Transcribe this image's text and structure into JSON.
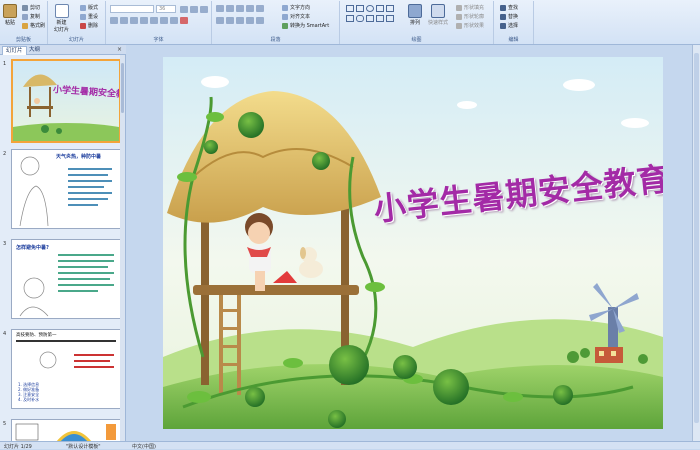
{
  "ribbon": {
    "clipboard": {
      "paste": "粘贴",
      "cut": "剪切",
      "copy": "复制",
      "format_painter": "格式刷",
      "label": "剪贴板"
    },
    "slides": {
      "new_slide": "新建",
      "new_slide2": "幻灯片",
      "layout": "版式",
      "reset": "重设",
      "delete": "删除",
      "label": "幻灯片"
    },
    "font": {
      "size": "36",
      "label": "字体"
    },
    "paragraph": {
      "text_direction": "文字方向",
      "align_text": "对齐文本",
      "convert_smartart": "转换为 SmartArt",
      "label": "段落"
    },
    "drawing": {
      "arrange": "排列",
      "quick_styles": "快速样式",
      "shape_fill": "形状填充",
      "shape_outline": "形状轮廓",
      "shape_effects": "形状效果",
      "label": "绘图"
    },
    "editing": {
      "find": "查找",
      "replace": "替换",
      "select": "选择",
      "label": "编辑"
    }
  },
  "panel": {
    "tab_slides": "幻灯片",
    "tab_outline": "大纲",
    "close": "×",
    "thumbs": [
      {
        "num": "1"
      },
      {
        "num": "2",
        "title": "天气炎热，种防中暑"
      },
      {
        "num": "3",
        "title": "怎样避免中暑?"
      },
      {
        "num": "4",
        "title": "高技要防、预防第一"
      },
      {
        "num": "5"
      }
    ],
    "thumb4_items": [
      "1. 选择信息",
      "2. 做好准备",
      "3. 注意安全",
      "4. 及时补水"
    ]
  },
  "slide": {
    "title": "小学生暑期安全教育"
  },
  "status": {
    "slide_info": "幻灯片 1/29",
    "theme": "\"默认设计模板\"",
    "language": "中文(中国)"
  },
  "colors": {
    "title": "#a32aa6",
    "ribbon_bg": "#dbe6f5",
    "accent": "#f3a43a"
  }
}
